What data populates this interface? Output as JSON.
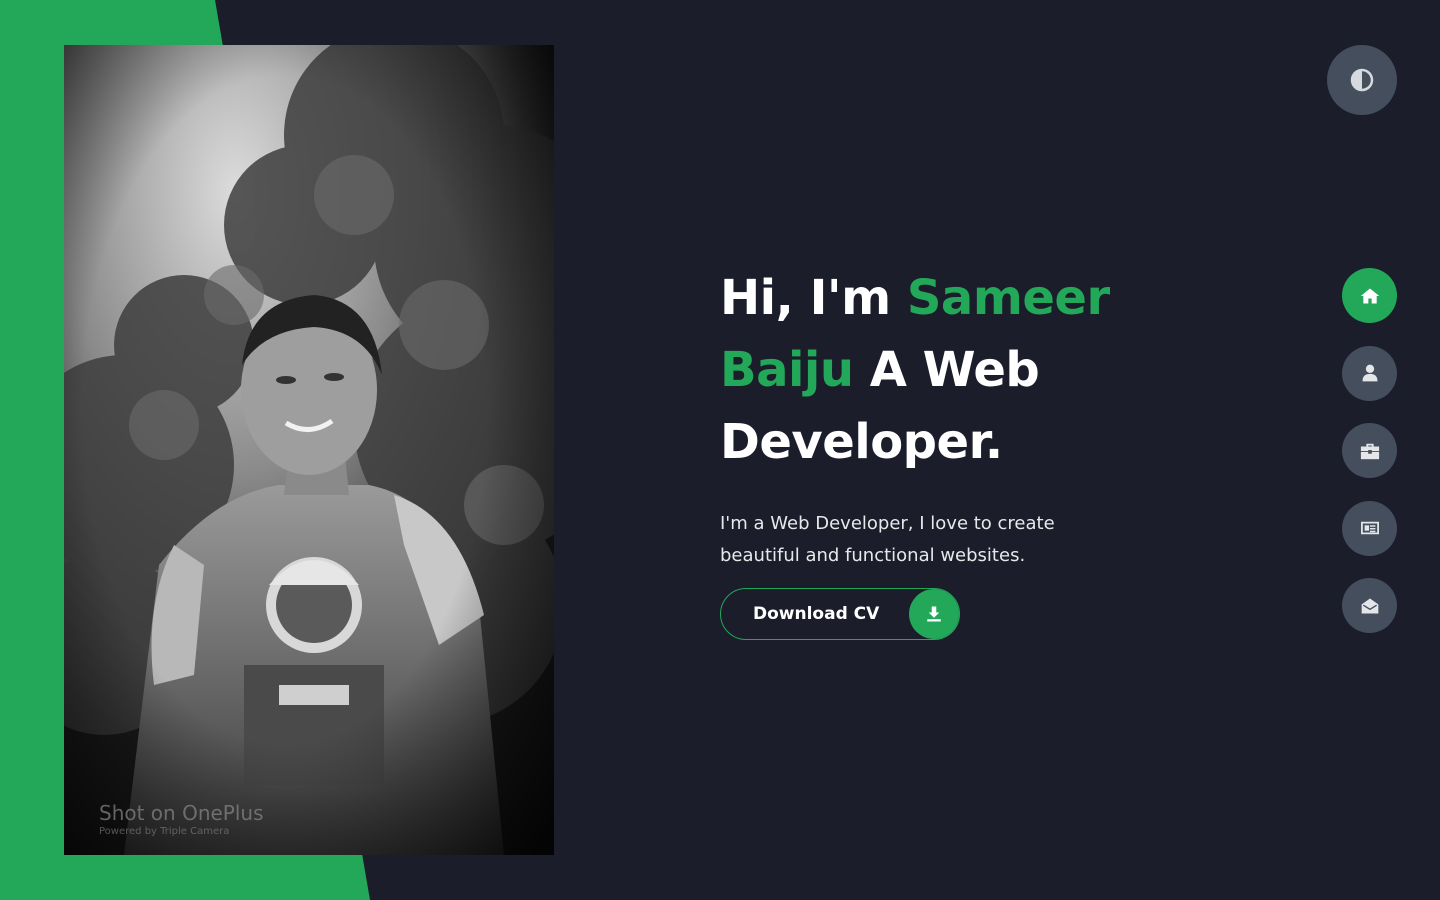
{
  "colors": {
    "accent": "#23a85a",
    "background": "#1b1d2a",
    "control": "#454e5d",
    "text": "#ffffff"
  },
  "hero": {
    "greeting": "Hi, I'm",
    "name_first": "Sameer",
    "name_last": "Baiju",
    "role": "A Web",
    "role_end": "Developer.",
    "description": "I'm a Web Developer, I love to create beautiful and functional websites."
  },
  "photo": {
    "alt": "Portrait photo",
    "watermark_main": "Shot on OnePlus",
    "watermark_sub": "Powered by Triple Camera"
  },
  "cv_button": {
    "label": "Download CV",
    "icon": "download-icon"
  },
  "theme_toggle": {
    "icon": "contrast-icon"
  },
  "nav": {
    "items": [
      {
        "name": "home",
        "icon": "home-icon",
        "active": true
      },
      {
        "name": "about",
        "icon": "user-icon",
        "active": false
      },
      {
        "name": "portfolio",
        "icon": "briefcase-icon",
        "active": false
      },
      {
        "name": "blog",
        "icon": "newspaper-icon",
        "active": false
      },
      {
        "name": "contact",
        "icon": "envelope-open-icon",
        "active": false
      }
    ]
  }
}
